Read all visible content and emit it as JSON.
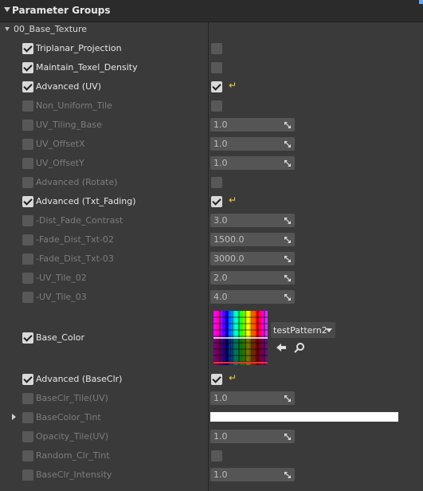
{
  "panel": {
    "title": "Parameter Groups"
  },
  "group": {
    "label": "00_Base_Texture"
  },
  "rows": [
    {
      "label": "Triplanar_Projection",
      "checked": true,
      "value_type": "checkbox",
      "value_checked": false
    },
    {
      "label": "Maintain_Texel_Density",
      "checked": true,
      "value_type": "checkbox",
      "value_checked": false
    },
    {
      "label": "Advanced (UV)",
      "checked": true,
      "value_type": "checkbox",
      "value_checked": true,
      "reset": true
    },
    {
      "label": "Non_Uniform_Tile",
      "checked": false,
      "value_type": "checkbox",
      "value_checked": false
    },
    {
      "label": "UV_Tiling_Base",
      "checked": false,
      "value_type": "number",
      "value": "1.0"
    },
    {
      "label": "UV_OffsetX",
      "checked": false,
      "value_type": "number",
      "value": "1.0"
    },
    {
      "label": "UV_OffsetY",
      "checked": false,
      "value_type": "number",
      "value": "1.0"
    },
    {
      "label": "Advanced (Rotate)",
      "checked": false,
      "value_type": "checkbox",
      "value_checked": false
    },
    {
      "label": "Advanced (Txt_Fading)",
      "checked": true,
      "value_type": "checkbox",
      "value_checked": true,
      "reset": true
    },
    {
      "label": "-Dist_Fade_Contrast",
      "checked": false,
      "value_type": "number",
      "value": "3.0"
    },
    {
      "label": "-Fade_Dist_Txt-02",
      "checked": false,
      "value_type": "number",
      "value": "1500.0"
    },
    {
      "label": "-Fade_Dist_Txt-03",
      "checked": false,
      "value_type": "number",
      "value": "3000.0"
    },
    {
      "label": "-UV_Tile_02",
      "checked": false,
      "value_type": "number",
      "value": "2.0"
    },
    {
      "label": "-UV_Tile_03",
      "checked": false,
      "value_type": "number",
      "value": "4.0"
    }
  ],
  "base_color": {
    "label": "Base_Color",
    "checked": true,
    "texture_name": "testPattern2",
    "icons": [
      "use-selected-arrow-icon",
      "browse-magnifier-icon"
    ]
  },
  "rows2": [
    {
      "label": "Advanced (BaseClr)",
      "checked": true,
      "value_type": "checkbox",
      "value_checked": true,
      "reset": true
    },
    {
      "label": "BaseClr_Tile(UV)",
      "checked": false,
      "value_type": "number",
      "value": "1.0"
    },
    {
      "label": "BaseColor_Tint",
      "checked": false,
      "value_type": "color",
      "color": "#ffffff",
      "expandable": true
    },
    {
      "label": "Opacity_Tile(UV)",
      "checked": false,
      "value_type": "number",
      "value": "1.0"
    },
    {
      "label": "Random_Clr_Tint",
      "checked": false,
      "value_type": "checkbox",
      "value_checked": false
    },
    {
      "label": "BaseClr_Intensity",
      "checked": false,
      "value_type": "number",
      "value": "1.0"
    }
  ],
  "colors": {
    "reset_arrow": "#f0d040",
    "panel_bg": "#3a3a3a",
    "header_bg": "#2b2b2b",
    "accent": "#6aa8ff"
  }
}
